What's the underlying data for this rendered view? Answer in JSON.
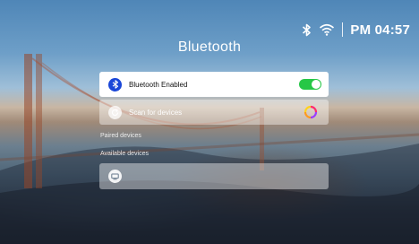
{
  "status_bar": {
    "icons": [
      "bluetooth-icon",
      "wifi-icon"
    ],
    "time": "PM 04:57"
  },
  "page": {
    "title": "Bluetooth"
  },
  "bluetooth_toggle": {
    "label": "Bluetooth Enabled",
    "enabled": true,
    "icon": "bluetooth-icon",
    "accent_color": "#26c746",
    "icon_color": "#1a47d8"
  },
  "scan": {
    "label": "Scan for devices",
    "icon": "refresh-icon",
    "spinner_icon": "loading-spinner-icon"
  },
  "sections": {
    "paired": "Paired devices",
    "available": "Available devices"
  },
  "available_devices": [
    {
      "name": "",
      "icon": "device-icon"
    }
  ]
}
